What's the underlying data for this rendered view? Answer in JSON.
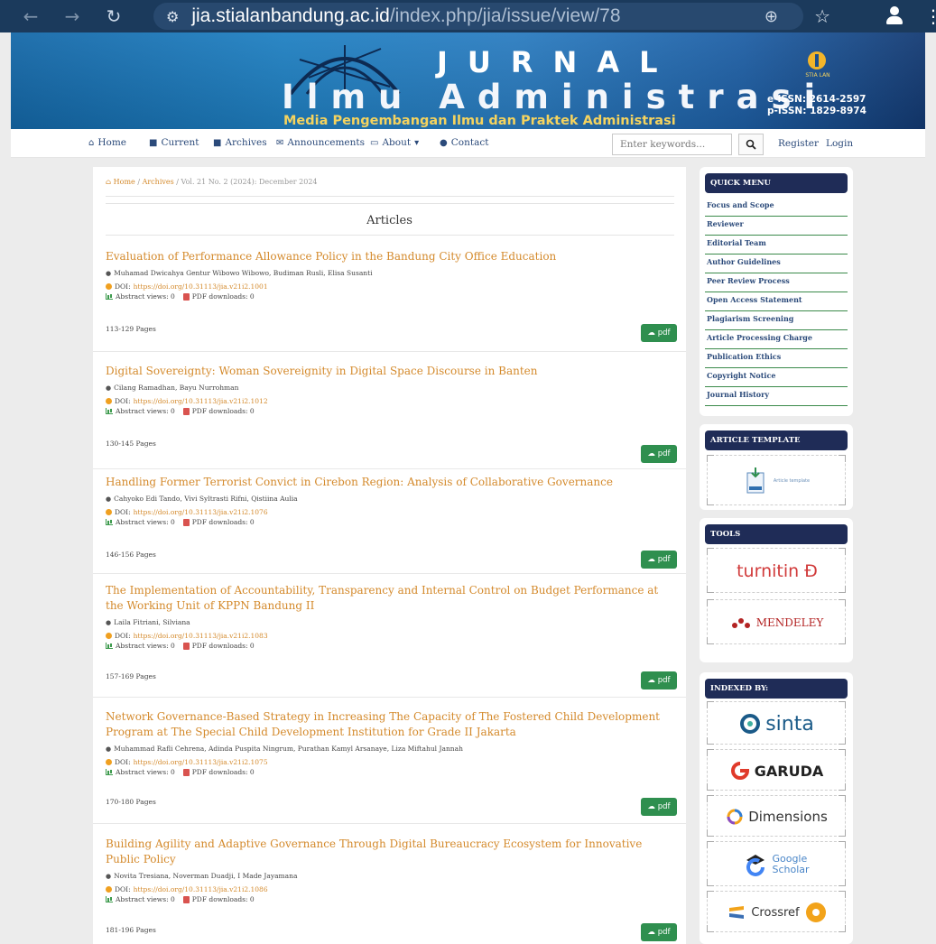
{
  "browser": {
    "url_host": "jia.stialanbandung.ac.id",
    "url_path": "/index.php/jia/issue/view/78"
  },
  "banner": {
    "line1": "JURNAL",
    "line2": "Ilmu Administrasi",
    "tagline": "Media Pengembangan Ilmu dan Praktek Administrasi",
    "logo_tag": "STIA LAN",
    "eissn": "e-ISSN: 2614-2597",
    "pissn": "p-ISSN: 1829-8974"
  },
  "nav": {
    "items": [
      {
        "label": "Home",
        "icon": "home-icon"
      },
      {
        "label": "Current",
        "icon": "folder-icon"
      },
      {
        "label": "Archives",
        "icon": "folder-icon"
      },
      {
        "label": "Announcements",
        "icon": "megaphone-icon"
      },
      {
        "label": "About",
        "icon": "monitor-icon"
      },
      {
        "label": "Contact",
        "icon": "user-icon"
      }
    ],
    "search_placeholder": "Enter keywords...",
    "register": "Register",
    "login": "Login"
  },
  "breadcrumb": {
    "home": "Home",
    "archives": "Archives",
    "current": "Vol. 21 No. 2 (2024): December 2024"
  },
  "section_title": "Articles",
  "articles": [
    {
      "title": "Evaluation of Performance Allowance Policy in the Bandung City Office Education",
      "authors": "Muhamad Dwicahya Gentur Wibowo Wibowo, Budiman Rusli, Elisa Susanti",
      "doi_label": "DOI:",
      "doi": "https://doi.org/10.31113/jia.v21i2.1001",
      "views": "Abstract views: 0",
      "downloads": "PDF downloads: 0",
      "pages": "113-129 Pages",
      "pdf": "pdf"
    },
    {
      "title": "Digital Sovereignty: Woman Sovereignity in Digital Space Discourse in Banten",
      "authors": "Cilang Ramadhan, Bayu Nurrohman",
      "doi_label": "DOI:",
      "doi": "https://doi.org/10.31113/jia.v21i2.1012",
      "views": "Abstract views: 0",
      "downloads": "PDF downloads: 0",
      "pages": "130-145 Pages",
      "pdf": "pdf"
    },
    {
      "title": "Handling Former Terrorist Convict in Cirebon Region: Analysis of Collaborative Governance",
      "authors": "Cahyoko Edi Tando, Vivi Syltrasti Rifni, Qistiina Aulia",
      "doi_label": "DOI:",
      "doi": "https://doi.org/10.31113/jia.v21i2.1076",
      "views": "Abstract views: 0",
      "downloads": "PDF downloads: 0",
      "pages": "146-156 Pages",
      "pdf": "pdf"
    },
    {
      "title": "The Implementation of Accountability, Transparency and Internal Control on Budget Performance at the Working Unit of KPPN Bandung II",
      "authors": "Laila Fitriani, Silviana",
      "doi_label": "DOI:",
      "doi": "https://doi.org/10.31113/jia.v21i2.1083",
      "views": "Abstract views: 0",
      "downloads": "PDF downloads: 0",
      "pages": "157-169 Pages",
      "pdf": "pdf"
    },
    {
      "title": "Network Governance-Based Strategy in Increasing The Capacity of The Fostered Child Development Program at The Special Child Development Institution for Grade II Jakarta",
      "authors": "Muhammad Rafli Cehrena, Adinda Puspita Ningrum, Purathan Kamyl Arsanaye, Liza Miftahul Jannah",
      "doi_label": "DOI:",
      "doi": "https://doi.org/10.31113/jia.v21i2.1075",
      "views": "Abstract views: 0",
      "downloads": "PDF downloads: 0",
      "pages": "170-180 Pages",
      "pdf": "pdf"
    },
    {
      "title": "Building Agility and Adaptive Governance Through Digital Bureaucracy Ecosystem for Innovative Public Policy",
      "authors": "Novita Tresiana, Noverman Duadji, I Made Jayamana",
      "doi_label": "DOI:",
      "doi": "https://doi.org/10.31113/jia.v21i2.1086",
      "views": "Abstract views: 0",
      "downloads": "PDF downloads: 0",
      "pages": "181-196 Pages",
      "pdf": "pdf"
    }
  ],
  "sidebar": {
    "quick_menu_title": "QUICK MENU",
    "quick_menu": [
      "Focus and Scope",
      "Reviewer",
      "Editorial Team",
      "Author Guidelines",
      "Peer Review Process",
      "Open Access Statement",
      "Plagiarism Screening",
      "Article Processing Charge",
      "Publication Ethics",
      "Copyright Notice",
      "Journal History"
    ],
    "template_title": "ARTICLE TEMPLATE",
    "template_label": "Article template",
    "tools_title": "TOOLS",
    "tools": [
      "turnitin",
      "MENDELEY"
    ],
    "indexed_title": "INDEXED BY:",
    "indexed": [
      "sinta",
      "GARUDA",
      "Dimensions",
      "Google",
      "Scholar",
      "Crossref"
    ]
  },
  "colors": {
    "accent_orange": "#d48a2c",
    "nav_blue": "#2b4a7a",
    "sidebar_header": "#1f2c57",
    "pdf_green": "#2f8f4f"
  }
}
